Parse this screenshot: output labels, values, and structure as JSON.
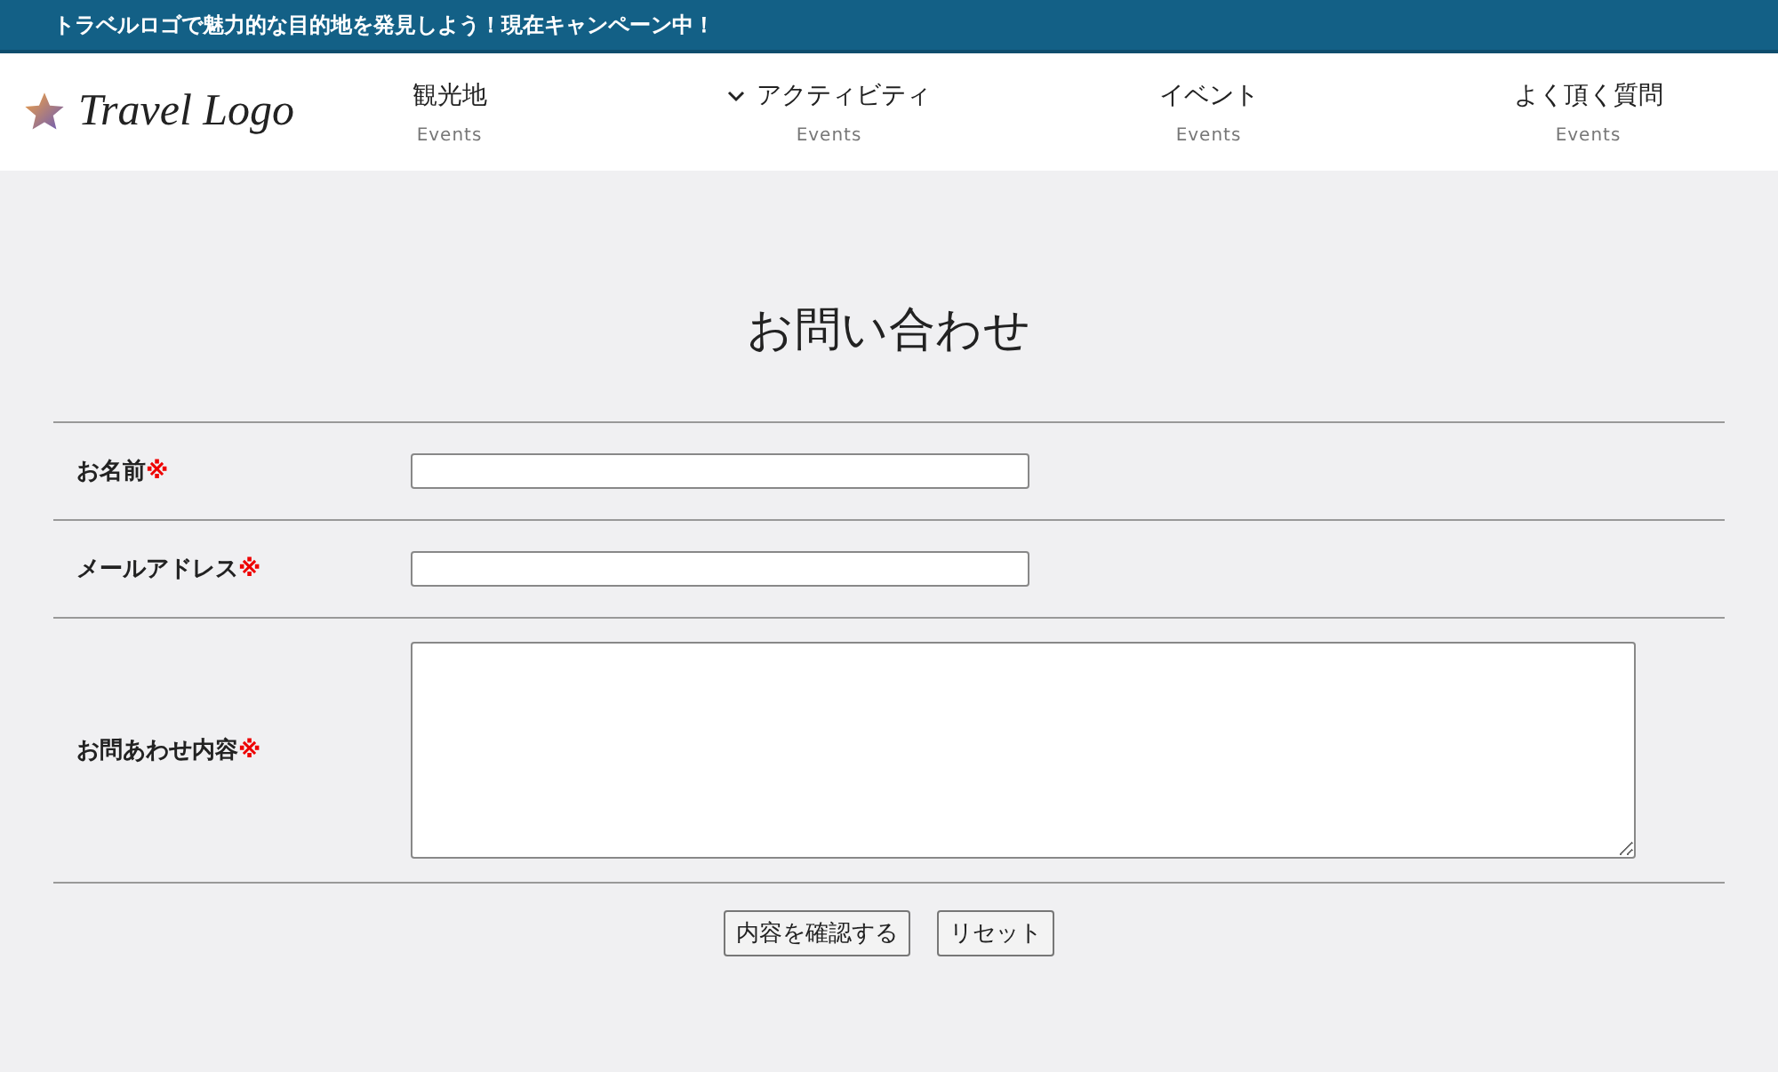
{
  "announcement": "トラベルロゴで魅力的な目的地を発見しよう！現在キャンペーン中！",
  "logo": {
    "text": "Travel Logo"
  },
  "nav": [
    {
      "label": "観光地",
      "sublabel": "Events",
      "dropdown": false
    },
    {
      "label": "アクティビティ",
      "sublabel": "Events",
      "dropdown": true
    },
    {
      "label": "イベント",
      "sublabel": "Events",
      "dropdown": false
    },
    {
      "label": "よく頂く質問",
      "sublabel": "Events",
      "dropdown": false
    }
  ],
  "title": "お問い合わせ",
  "fields": [
    {
      "label": "お名前",
      "required_mark": "※",
      "kind": "input"
    },
    {
      "label": "メールアドレス",
      "required_mark": "※",
      "kind": "input"
    },
    {
      "label": "お問あわせ内容",
      "required_mark": "※",
      "kind": "textarea"
    }
  ],
  "buttons": [
    "内容を確認する",
    "リセット"
  ]
}
